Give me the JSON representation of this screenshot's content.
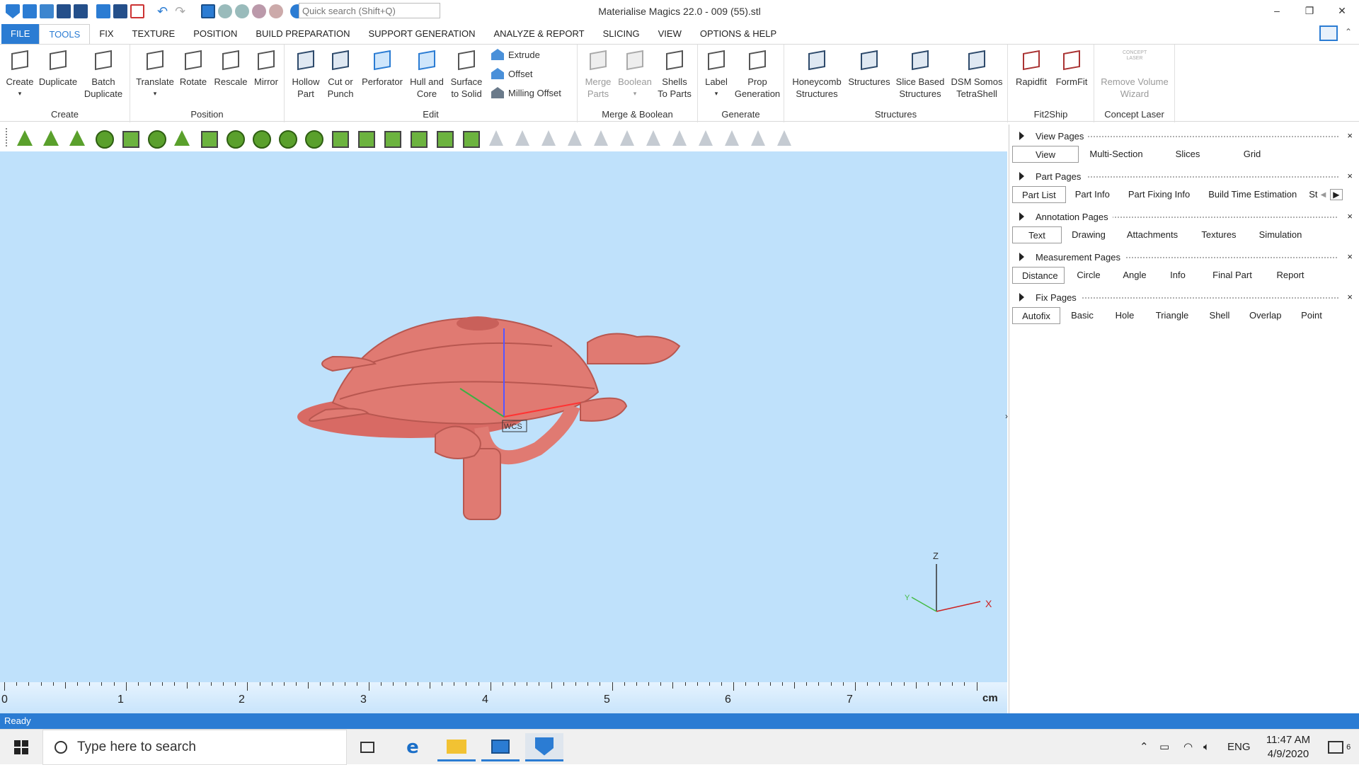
{
  "titlebar": {
    "title": "Materialise Magics 22.0 - 009 (55).stl",
    "search_placeholder": "Quick search (Shift+Q)",
    "minimize": "–",
    "restore": "❐",
    "close": "✕"
  },
  "menu": {
    "file": "FILE",
    "tools": "TOOLS",
    "fix": "FIX",
    "texture": "TEXTURE",
    "position": "POSITION",
    "build_prep": "BUILD PREPARATION",
    "support": "SUPPORT GENERATION",
    "analyze": "ANALYZE & REPORT",
    "slicing": "SLICING",
    "view": "VIEW",
    "options": "OPTIONS & HELP"
  },
  "ribbon": {
    "create_group": "Create",
    "create": "Create",
    "duplicate": "Duplicate",
    "batch_duplicate_1": "Batch",
    "batch_duplicate_2": "Duplicate",
    "position_group": "Position",
    "translate": "Translate",
    "rotate": "Rotate",
    "rescale": "Rescale",
    "mirror": "Mirror",
    "edit_group": "Edit",
    "hollow_1": "Hollow",
    "hollow_2": "Part",
    "cut_1": "Cut or",
    "cut_2": "Punch",
    "perforator": "Perforator",
    "hull_1": "Hull and",
    "hull_2": "Core",
    "surface_1": "Surface",
    "surface_2": "to Solid",
    "extrude": "Extrude",
    "offset": "Offset",
    "milling_offset": "Milling Offset",
    "merge_group": "Merge & Boolean",
    "merge_1": "Merge",
    "merge_2": "Parts",
    "boolean": "Boolean",
    "shells_1": "Shells",
    "shells_2": "To Parts",
    "generate_group": "Generate",
    "label": "Label",
    "prop_1": "Prop",
    "prop_2": "Generation",
    "structures_group": "Structures",
    "honeycomb_1": "Honeycomb",
    "honeycomb_2": "Structures",
    "structures": "Structures",
    "slice_based_1": "Slice Based",
    "slice_based_2": "Structures",
    "dsm_1": "DSM Somos",
    "dsm_2": "TetraShell",
    "fit2ship_group": "Fit2Ship",
    "rapidfit": "Rapidfit",
    "formfit": "FormFit",
    "concept_group": "Concept Laser",
    "remove_volume_1": "Remove Volume",
    "remove_volume_2": "Wizard",
    "concept_logo": "CONCEPT LASER"
  },
  "viewport": {
    "wcs_label": "WCS",
    "axis_x": "X",
    "axis_y": "Y",
    "axis_z": "Z"
  },
  "ruler": {
    "labels": [
      "0",
      "1",
      "2",
      "3",
      "4",
      "5",
      "6",
      "7"
    ],
    "unit": "cm"
  },
  "status": {
    "text": "Ready"
  },
  "panels": {
    "view_pages": {
      "title": "View Pages",
      "tabs": [
        "View",
        "Multi-Section",
        "Slices",
        "Grid"
      ]
    },
    "part_pages": {
      "title": "Part Pages",
      "tabs": [
        "Part List",
        "Part Info",
        "Part Fixing Info",
        "Build Time Estimation",
        "St"
      ]
    },
    "annotation_pages": {
      "title": "Annotation Pages",
      "tabs": [
        "Text",
        "Drawing",
        "Attachments",
        "Textures",
        "Simulation"
      ]
    },
    "measurement_pages": {
      "title": "Measurement Pages",
      "tabs": [
        "Distance",
        "Circle",
        "Angle",
        "Info",
        "Final Part",
        "Report"
      ]
    },
    "fix_pages": {
      "title": "Fix Pages",
      "tabs": [
        "Autofix",
        "Basic",
        "Hole",
        "Triangle",
        "Shell",
        "Overlap",
        "Point"
      ]
    },
    "close_glyph": "×"
  },
  "taskbar": {
    "search_placeholder": "Type here to search",
    "language": "ENG",
    "time": "11:47 AM",
    "date": "4/9/2020",
    "notification_count": "6"
  },
  "colors": {
    "accent": "#2b7cd3",
    "viewport_bg": "#bfe1fb",
    "model": "#e2706a"
  }
}
